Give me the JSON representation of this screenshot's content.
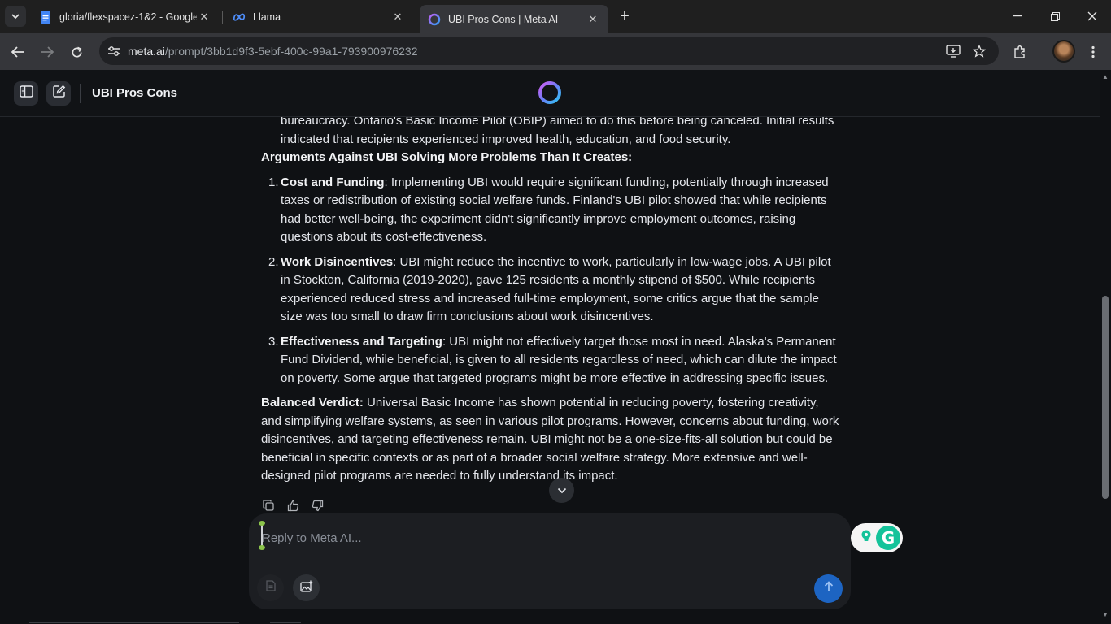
{
  "browser": {
    "tabs": [
      {
        "title": "gloria/flexspacez-1&2 - Google",
        "icon": "google-docs-icon",
        "active": false
      },
      {
        "title": "Llama",
        "icon": "meta-icon",
        "active": false
      },
      {
        "title": "UBI Pros Cons | Meta AI",
        "icon": "meta-ai-icon",
        "active": true
      }
    ],
    "url_host": "meta.ai",
    "url_path": "/prompt/3bb1d9f3-5ebf-400c-99a1-793900976232"
  },
  "header": {
    "title": "UBI Pros Cons"
  },
  "message": {
    "intro_continuation": "bureaucracy. Ontario's Basic Income Pilot (OBIP) aimed to do this before being canceled. Initial results indicated that recipients experienced improved health, education, and food security.",
    "against_heading": "Arguments Against UBI Solving More Problems Than It Creates:",
    "against_items": [
      {
        "num": "1.",
        "title": "Cost and Funding",
        "text": ": Implementing UBI would require significant funding, potentially through increased taxes or redistribution of existing social welfare funds. Finland's UBI pilot showed that while recipients had better well-being, the experiment didn't significantly improve employment outcomes, raising questions about its cost-effectiveness."
      },
      {
        "num": "2.",
        "title": "Work Disincentives",
        "text": ": UBI might reduce the incentive to work, particularly in low-wage jobs. A UBI pilot in Stockton, California (2019-2020), gave 125 residents a monthly stipend of $500. While recipients experienced reduced stress and increased full-time employment, some critics argue that the sample size was too small to draw firm conclusions about work disincentives."
      },
      {
        "num": "3.",
        "title": "Effectiveness and Targeting",
        "text": ": UBI might not effectively target those most in need. Alaska's Permanent Fund Dividend, while beneficial, is given to all residents regardless of need, which can dilute the impact on poverty. Some argue that targeted programs might be more effective in addressing specific issues."
      }
    ],
    "verdict_label": "Balanced Verdict:",
    "verdict_text": " Universal Basic Income has shown potential in reducing poverty, fostering creativity, and simplifying welfare systems, as seen in various pilot programs. However, concerns about funding, work disincentives, and targeting effectiveness remain. UBI might not be a one-size-fits-all solution but could be beneficial in specific contexts or as part of a broader social welfare strategy. More extensive and well-designed pilot programs are needed to fully understand its impact."
  },
  "composer": {
    "placeholder": "Reply to Meta AI..."
  },
  "colors": {
    "background": "#0f1114",
    "send_button": "#1d64c2",
    "grammarly": "#15c39a"
  }
}
